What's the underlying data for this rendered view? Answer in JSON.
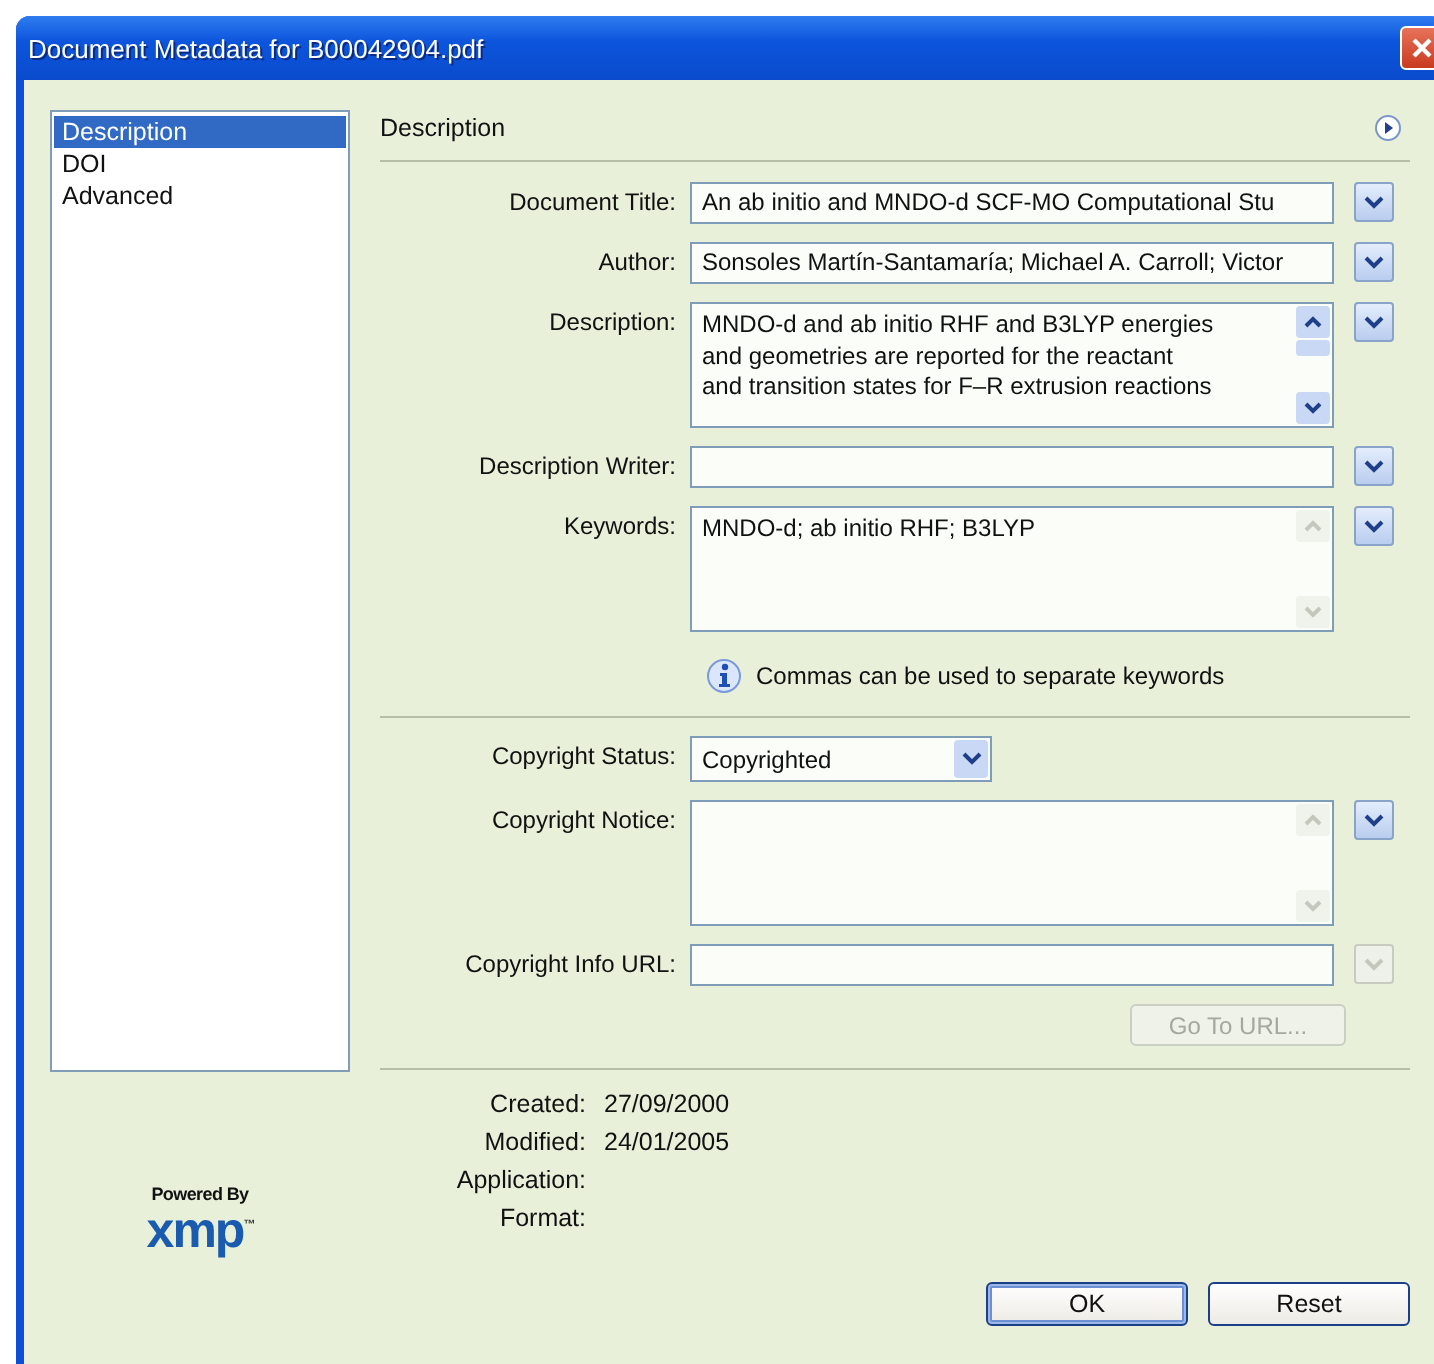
{
  "window": {
    "title": "Document Metadata for B00042904.pdf"
  },
  "sidebar": {
    "items": [
      {
        "label": "Description",
        "selected": true
      },
      {
        "label": "DOI",
        "selected": false
      },
      {
        "label": "Advanced",
        "selected": false
      }
    ]
  },
  "panel": {
    "heading": "Description"
  },
  "fields": [
    {
      "kind": "text",
      "label": "Document Title:",
      "value": "An ab initio and MNDO-d SCF-MO Computational Stu",
      "menu_disabled": false
    },
    {
      "kind": "text",
      "label": "Author:",
      "value": "Sonsoles Martín-Santamaría; Michael A. Carroll; Victor",
      "menu_disabled": false
    },
    {
      "kind": "multiline",
      "label": "Description:",
      "value": "MNDO-d and ab initio RHF and B3LYP energies\nand geometries are reported for the reactant\nand transition states for F–R extrusion reactions",
      "scroll_enabled": true,
      "menu_disabled": false
    },
    {
      "kind": "text",
      "label": "Description Writer:",
      "menu_disabled": false
    },
    {
      "kind": "multiline",
      "label": "Keywords:",
      "value": "MNDO-d; ab initio RHF; B3LYP",
      "scroll_enabled": false,
      "menu_disabled": false
    }
  ],
  "hint": "Commas can be used to separate keywords",
  "copyright_fields": [
    {
      "kind": "select",
      "label": "Copyright Status:",
      "value": "Copyrighted"
    },
    {
      "kind": "multiline",
      "label": "Copyright Notice:",
      "scroll_enabled": false,
      "menu_disabled": false
    },
    {
      "kind": "text",
      "label": "Copyright Info URL:",
      "menu_disabled": true
    }
  ],
  "go_to_url": {
    "label": "Go To URL...",
    "disabled": true
  },
  "info": [
    {
      "label": "Created:",
      "value": "27/09/2000"
    },
    {
      "label": "Modified:",
      "value": "24/01/2005"
    },
    {
      "label": "Application:"
    },
    {
      "label": "Format:"
    }
  ],
  "logo": {
    "tagline": "Powered By",
    "wordmark": "xmp$^{™}$"
  },
  "buttons": [
    {
      "label": "OK",
      "default": true
    },
    {
      "label": "Reset",
      "default": false
    }
  ]
}
